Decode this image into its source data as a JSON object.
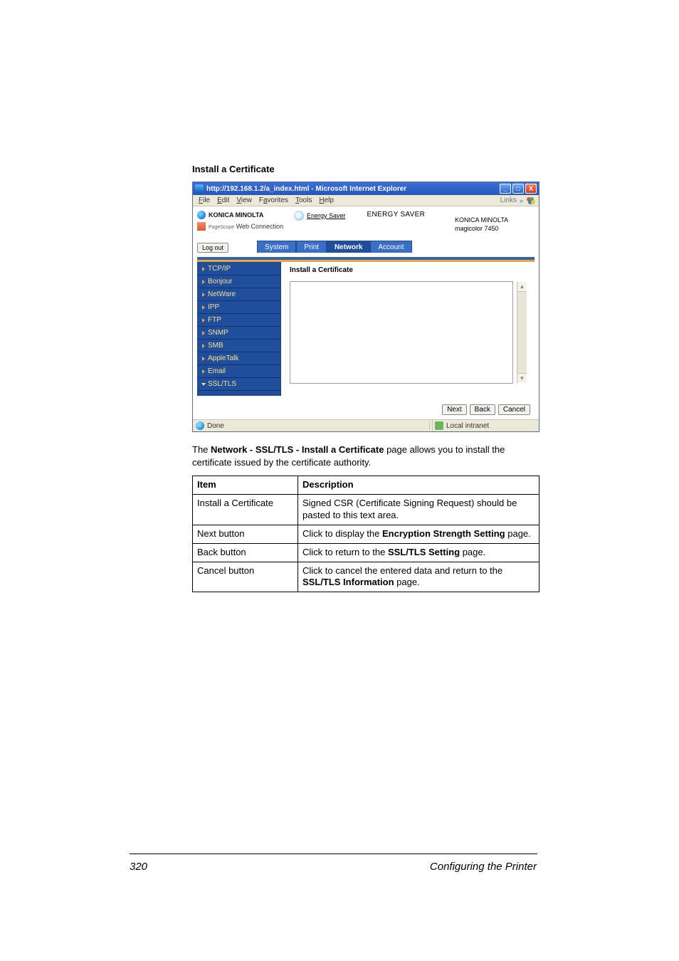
{
  "doc": {
    "section_title": "Install a Certificate",
    "description_pre": "The ",
    "description_bold": "Network - SSL/TLS - Install a Certificate",
    "description_post": " page allows you to install the certificate issued by the certificate authority.",
    "table": {
      "headers": {
        "item": "Item",
        "desc": "Description"
      },
      "rows": [
        {
          "item": "Install a Certificate",
          "desc": "Signed CSR (Certificate Signing Request) should be pasted to this text area."
        },
        {
          "item": "Next button",
          "desc_pre": "Click to display the ",
          "desc_bold": "Encryption Strength Setting",
          "desc_post": " page."
        },
        {
          "item": "Back button",
          "desc_pre": "Click to return to the ",
          "desc_bold": "SSL/TLS Setting",
          "desc_post": " page."
        },
        {
          "item": "Cancel button",
          "desc_pre": "Click to cancel the entered data and return to the ",
          "desc_bold": "SSL/TLS Information",
          "desc_post": " page."
        }
      ]
    },
    "page_number": "320",
    "footer_title": "Configuring the Printer"
  },
  "browser": {
    "title": "http://192.168.1.2/a_index.html - Microsoft Internet Explorer",
    "win": {
      "min": "_",
      "max": "□",
      "close": "X"
    },
    "menu": {
      "file": "File",
      "edit": "Edit",
      "view": "View",
      "fav": "Favorites",
      "tools": "Tools",
      "help": "Help",
      "links": "Links",
      "chev": "»"
    },
    "header": {
      "brand": "KONICA MINOLTA",
      "pagescope": "PageScope",
      "webconn": "Web Connection",
      "energy_saver": "Energy Saver",
      "energy_head": "ENERGY SAVER",
      "maker": "KONICA MINOLTA",
      "model": "magicolor 7450"
    },
    "logout": "Log out",
    "tabs": {
      "system": "System",
      "print": "Print",
      "network": "Network",
      "account": "Account"
    },
    "sidebar": {
      "tcpip": "TCP/IP",
      "bonjour": "Bonjour",
      "netware": "NetWare",
      "ipp": "IPP",
      "ftp": "FTP",
      "snmp": "SNMP",
      "smb": "SMB",
      "appletalk": "AppleTalk",
      "email": "Email",
      "ssltls": "SSL/TLS"
    },
    "content": {
      "heading": "Install a Certificate"
    },
    "buttons": {
      "next": "Next",
      "back": "Back",
      "cancel": "Cancel"
    },
    "scroll": {
      "up": "▲",
      "down": "▼"
    },
    "status": {
      "done": "Done",
      "zone": "Local intranet"
    }
  }
}
